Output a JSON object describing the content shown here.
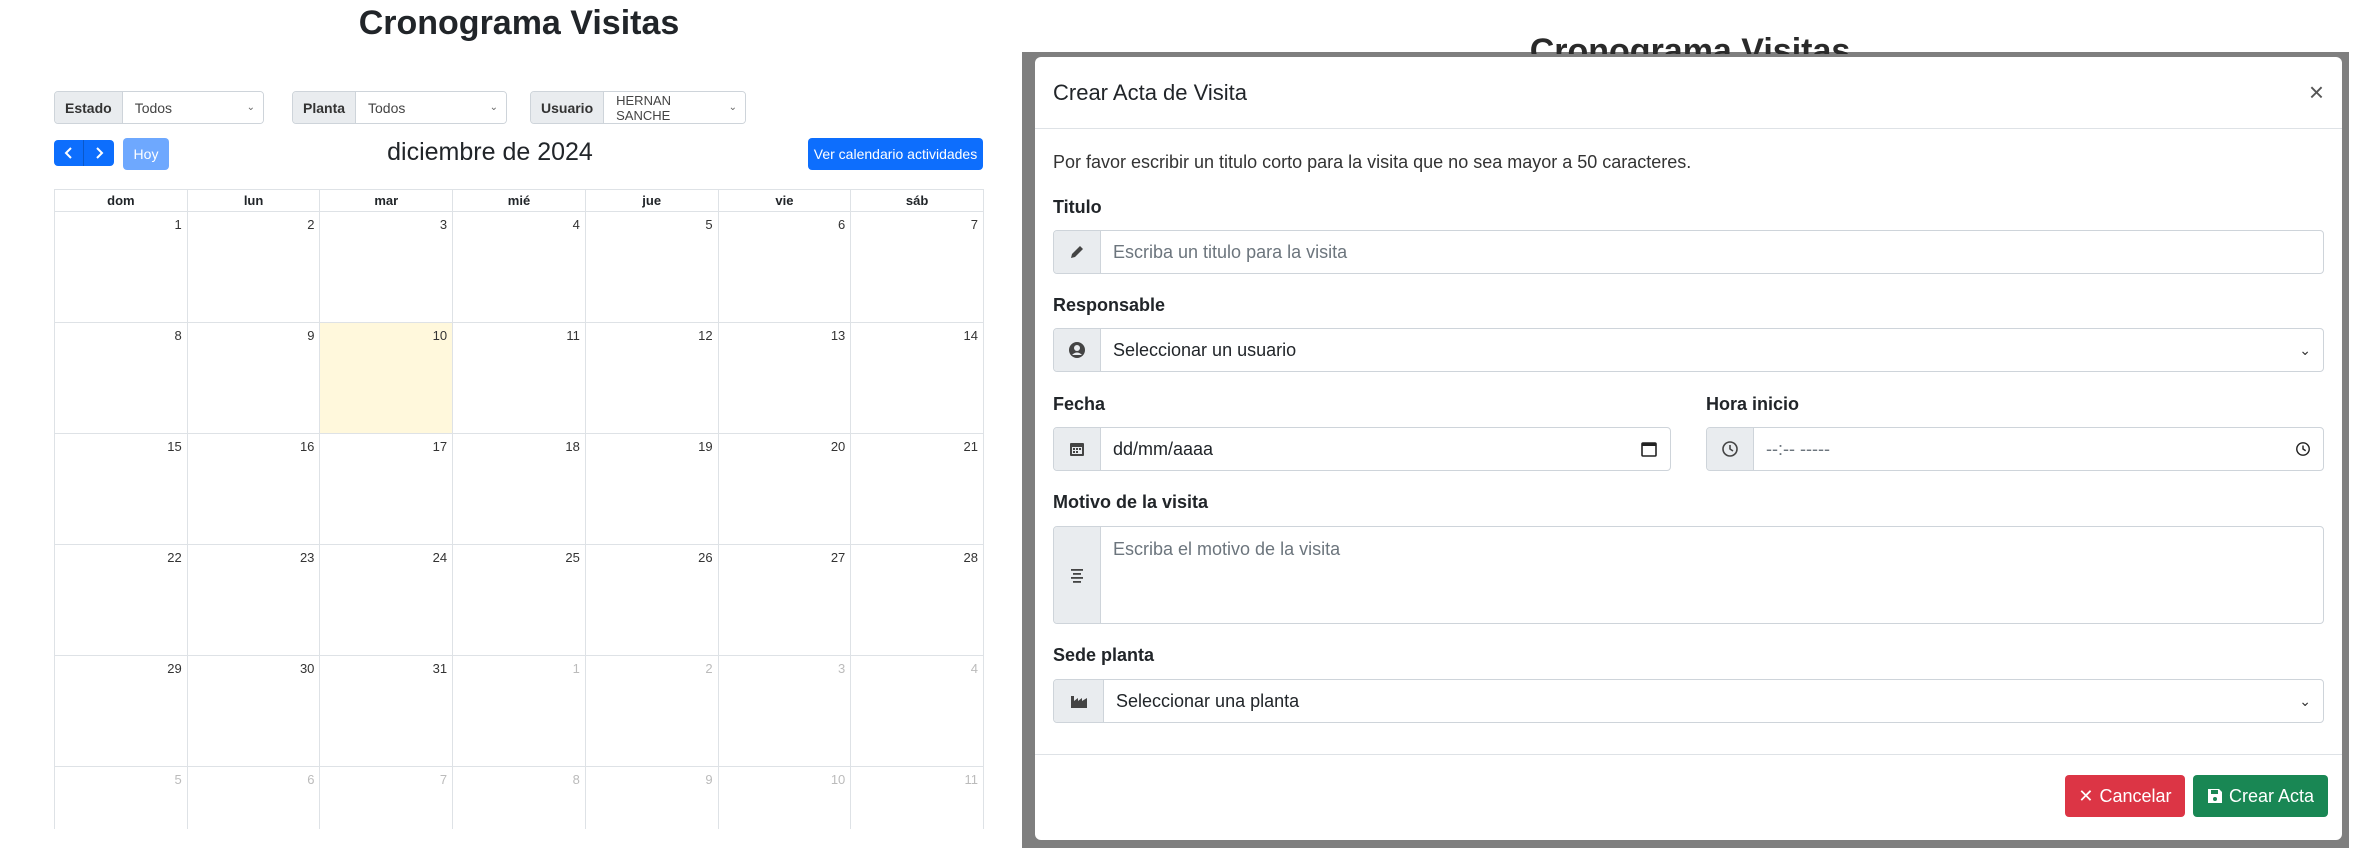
{
  "page": {
    "title": "Cronograma Visitas"
  },
  "filters": [
    {
      "label": "Estado",
      "value": "Todos"
    },
    {
      "label": "Planta",
      "value": "Todos"
    },
    {
      "label": "Usuario",
      "value": "HERNAN SANCHE"
    }
  ],
  "calendar": {
    "prev_icon": "chevron-left-icon",
    "next_icon": "chevron-right-icon",
    "today_label": "Hoy",
    "month_title": "diciembre de 2024",
    "activities_button": "Ver calendario actividades",
    "weekdays": [
      "dom",
      "lun",
      "mar",
      "mié",
      "jue",
      "vie",
      "sáb"
    ],
    "today_day": 10,
    "weeks": [
      [
        1,
        2,
        3,
        4,
        5,
        6,
        7
      ],
      [
        8,
        9,
        10,
        11,
        12,
        13,
        14
      ],
      [
        15,
        16,
        17,
        18,
        19,
        20,
        21
      ],
      [
        22,
        23,
        24,
        25,
        26,
        27,
        28
      ],
      [
        29,
        30,
        31,
        1,
        2,
        3,
        4
      ],
      [
        5,
        6,
        7,
        8,
        9,
        10,
        11
      ]
    ]
  },
  "background_title": "Cronograma Visitas",
  "modal": {
    "title": "Crear Acta de Visita",
    "close_label": "×",
    "intro": "Por favor escribir un titulo corto para la visita que no sea mayor a 50 caracteres.",
    "titulo": {
      "label": "Titulo",
      "placeholder": "Escriba un titulo para la visita",
      "icon": "pencil-icon"
    },
    "responsable": {
      "label": "Responsable",
      "value": "Seleccionar un usuario",
      "icon": "user-circle-icon"
    },
    "fecha": {
      "label": "Fecha",
      "placeholder": "dd/mm/aaaa",
      "icon": "calendar-icon"
    },
    "hora": {
      "label": "Hora inicio",
      "placeholder": "--:-- -----",
      "icon": "clock-icon"
    },
    "motivo": {
      "label": "Motivo de la visita",
      "placeholder": "Escriba el motivo de la visita",
      "icon": "align-center-icon"
    },
    "sede": {
      "label": "Sede planta",
      "value": "Seleccionar una planta",
      "icon": "industry-icon"
    },
    "cancel_label": "Cancelar",
    "create_label": "Crear Acta"
  },
  "colors": {
    "primary": "#0d6efd",
    "today_bg": "#fff8dc",
    "danger": "#dc3545",
    "success": "#198754",
    "overlay": "#7f7f7f"
  }
}
